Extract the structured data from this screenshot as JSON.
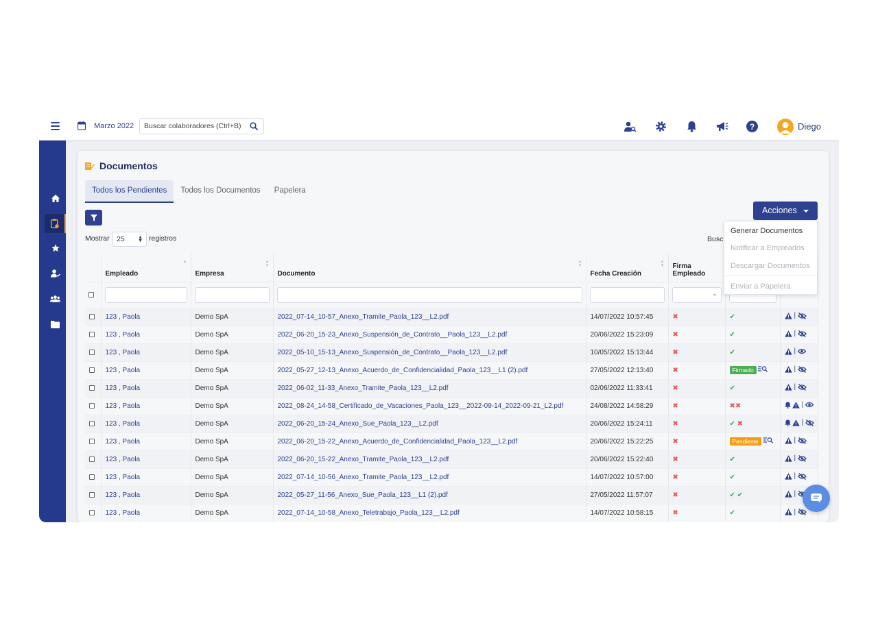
{
  "header": {
    "date_label": "Marzo 2022",
    "search_placeholder": "Buscar colaboradores (Ctrl+B)",
    "user_name": "Diego"
  },
  "page": {
    "title": "Documentos",
    "tabs": [
      "Todos los Pendientes",
      "Todos los Documentos",
      "Papelera"
    ],
    "active_tab": 0,
    "acciones_label": "Acciones",
    "mostrar_label": "Mostrar",
    "registros_value": "25",
    "registros_label": "registros",
    "buscar_label": "Busc"
  },
  "dropdown": {
    "items": [
      {
        "label": "Generar Documentos",
        "enabled": true
      },
      {
        "label": "Notificar a Empleados",
        "enabled": false
      },
      {
        "label": "Descargar Documentos",
        "enabled": false
      },
      {
        "label": "Enviar a Papelera",
        "enabled": false
      }
    ]
  },
  "table": {
    "columns": [
      "Empleado",
      "Empresa",
      "Documento",
      "Fecha Creación",
      "Firma Empleado",
      "",
      ""
    ],
    "rows": [
      {
        "empleado": "123 , Paola",
        "empresa": "Demo SpA",
        "documento": "2022_07-14_10-57_Anexo_Tramite_Paola_123__L2.pdf",
        "fecha": "14/07/2022 10:57:45",
        "firma": "x",
        "col6": "v",
        "acts": "warn|eyeoff"
      },
      {
        "empleado": "123 , Paola",
        "empresa": "Demo SpA",
        "documento": "2022_06-20_15-23_Anexo_Suspensión_de_Contrato__Paola_123__L2.pdf",
        "fecha": "20/06/2022 15:23:09",
        "firma": "x",
        "col6": "v",
        "acts": "warn|eyeoff"
      },
      {
        "empleado": "123 , Paola",
        "empresa": "Demo SpA",
        "documento": "2022_05-10_15-13_Anexo_Suspensión_de_Contrato__Paola_123__L2.pdf",
        "fecha": "10/05/2022 15:13:44",
        "firma": "x",
        "col6": "v",
        "acts": "warn|eye"
      },
      {
        "empleado": "123 , Paola",
        "empresa": "Demo SpA",
        "documento": "2022_05-27_12-13_Anexo_Acuerdo_de_Confidencialidad_Paola_123__L1 (2).pdf",
        "fecha": "27/05/2022 12:13:40",
        "firma": "x",
        "col6": "badge-firmado",
        "acts": "warn|eyeoff"
      },
      {
        "empleado": "123 , Paola",
        "empresa": "Demo SpA",
        "documento": "2022_06-02_11-33_Anexo_Tramite_Paola_123__L2.pdf",
        "fecha": "02/06/2022 11:33:41",
        "firma": "x",
        "col6": "v",
        "acts": "warn|eyeoff"
      },
      {
        "empleado": "123 , Paola",
        "empresa": "Demo SpA",
        "documento": "2022_08-24_14-58_Certificado_de_Vacaciones_Paola_123__2022-09-14_2022-09-21_L2.pdf",
        "fecha": "24/08/2022 14:58:29",
        "firma": "x",
        "col6": "xx",
        "acts": "bell-warn|eye"
      },
      {
        "empleado": "123 , Paola",
        "empresa": "Demo SpA",
        "documento": "2022_06-20_15-24_Anexo_Sue_Paola_123__L2.pdf",
        "fecha": "20/06/2022 15:24:11",
        "firma": "x",
        "col6": "vx",
        "acts": "bell-warn|eyeoff"
      },
      {
        "empleado": "123 , Paola",
        "empresa": "Demo SpA",
        "documento": "2022_06-20_15-22_Anexo_Acuerdo_de_Confidencialidad_Paola_123__L2.pdf",
        "fecha": "20/06/2022 15:22:25",
        "firma": "x",
        "col6": "badge-pendiente",
        "acts": "warn|eyeoff"
      },
      {
        "empleado": "123 , Paola",
        "empresa": "Demo SpA",
        "documento": "2022_06-20_15-22_Anexo_Tramite_Paola_123__L2.pdf",
        "fecha": "20/06/2022 15:22:40",
        "firma": "x",
        "col6": "v",
        "acts": "warn|eyeoff"
      },
      {
        "empleado": "123 , Paola",
        "empresa": "Demo SpA",
        "documento": "2022_07-14_10-56_Anexo_Tramite_Paola_123__L2.pdf",
        "fecha": "14/07/2022 10:57:00",
        "firma": "x",
        "col6": "v",
        "acts": "warn|eyeoff"
      },
      {
        "empleado": "123 , Paola",
        "empresa": "Demo SpA",
        "documento": "2022_05-27_11-56_Anexo_Sue_Paola_123__L1 (2).pdf",
        "fecha": "27/05/2022 11:57:07",
        "firma": "x",
        "col6": "vv",
        "acts": "warn|eyeoff"
      },
      {
        "empleado": "123 , Paola",
        "empresa": "Demo SpA",
        "documento": "2022_07-14_10-58_Anexo_Teletrabajo_Paola_123__L2.pdf",
        "fecha": "14/07/2022 10:58:15",
        "firma": "x",
        "col6": "v",
        "acts": "warn|eyeoff"
      }
    ],
    "badges": {
      "firmado": "Firmado",
      "pendiente": "Pendiente"
    }
  },
  "colors": {
    "primary": "#2d4190",
    "accent": "#f5a623",
    "danger": "#e15858",
    "success": "#3aa55a"
  }
}
